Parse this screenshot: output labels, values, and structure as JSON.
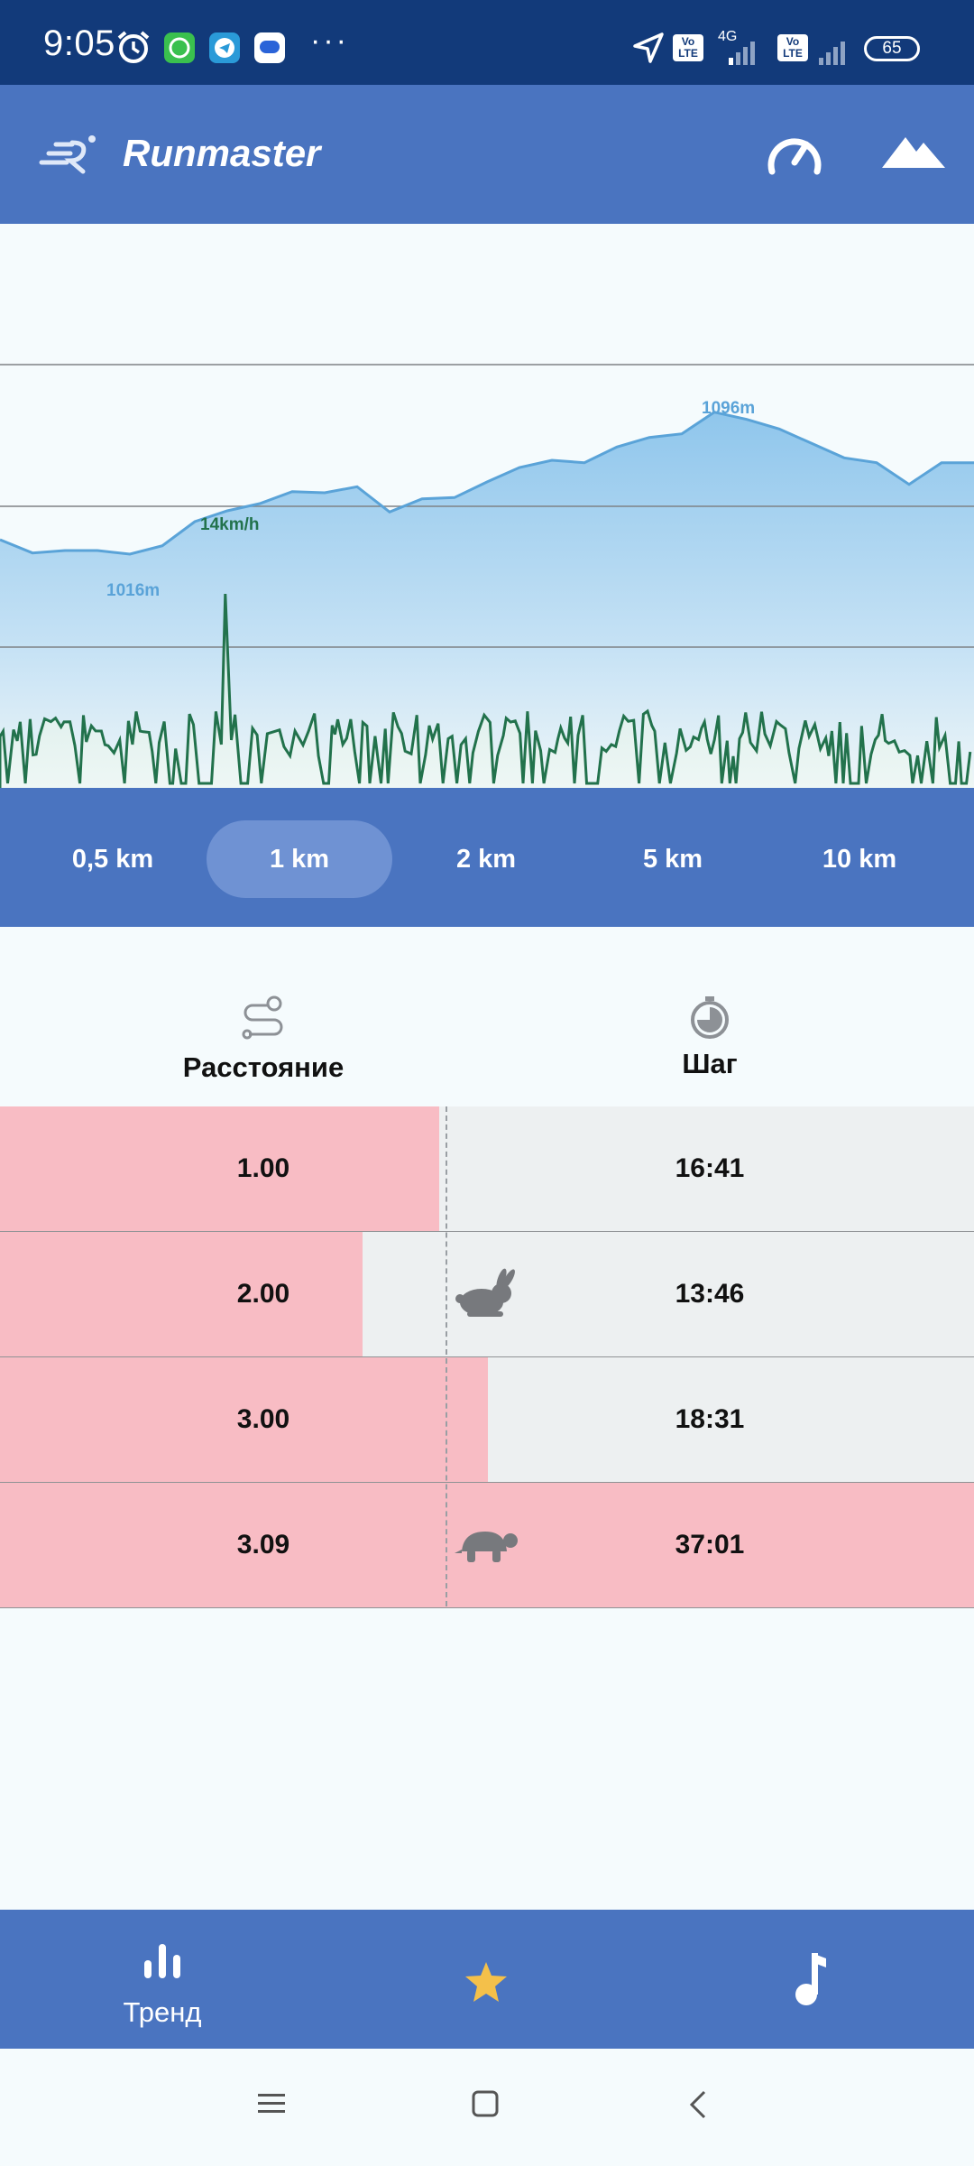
{
  "status_bar": {
    "time": "9:05",
    "icons": [
      "alarm-icon",
      "whatsapp-icon",
      "telegram-icon",
      "message-icon",
      "more-icon",
      "location-icon",
      "volte-icon",
      "signal-icon",
      "battery-icon"
    ],
    "network": "4G",
    "battery": "65"
  },
  "app_bar": {
    "title": "Runmaster",
    "icons": [
      "runmaster-logo-icon",
      "speedometer-icon",
      "mountain-icon"
    ],
    "accent": "#4a74c0"
  },
  "chart_data": {
    "type": "area",
    "series": [
      {
        "kind": "elevation",
        "unit": "m",
        "color": "#5aa3d8",
        "values": [
          1030,
          1019,
          1021,
          1021,
          1018,
          1025,
          1045,
          1054,
          1060,
          1070,
          1069,
          1074,
          1053,
          1064,
          1065,
          1078,
          1090,
          1096,
          1094,
          1107,
          1115,
          1118,
          1136,
          1130,
          1122,
          1110,
          1098,
          1094,
          1076,
          1094,
          1094
        ]
      },
      {
        "kind": "speed",
        "unit": "km/h",
        "color": "#22724c",
        "spike_value": 14
      }
    ],
    "annotations": [
      {
        "text": "1016m",
        "color": "#5aa3d8"
      },
      {
        "text": "1096m",
        "color": "#5aa3d8"
      },
      {
        "text": "14km/h",
        "color": "#22724c"
      }
    ],
    "gridlines": true
  },
  "segments": {
    "options": [
      "0,5 km",
      "1 km",
      "2 km",
      "5 km",
      "10 km"
    ],
    "selected_index": 1
  },
  "columns": {
    "distance": {
      "label": "Расстояние",
      "icon": "route-icon"
    },
    "pace": {
      "label": "Шаг",
      "icon": "stopwatch-icon"
    }
  },
  "splits": [
    {
      "distance": "1.00",
      "pace": "16:41",
      "bar_fraction": 0.451,
      "marker": ""
    },
    {
      "distance": "2.00",
      "pace": "13:46",
      "bar_fraction": 0.372,
      "marker": "rabbit-icon"
    },
    {
      "distance": "3.00",
      "pace": "18:31",
      "bar_fraction": 0.501,
      "marker": ""
    },
    {
      "distance": "3.09",
      "pace": "37:01",
      "bar_fraction": 1.0,
      "marker": "turtle-icon"
    }
  ],
  "colors": {
    "split_bar": "#f8bcc4",
    "row_bg": "#edf0f1",
    "star": "#f4c04a"
  },
  "bottom_nav": {
    "items": [
      {
        "label": "Тренд",
        "icon": "bar-chart-icon"
      },
      {
        "label": "",
        "icon": "star-icon"
      },
      {
        "label": "",
        "icon": "music-note-icon"
      }
    ]
  },
  "system_nav": {
    "icons": [
      "menu-icon",
      "home-icon",
      "back-icon"
    ]
  }
}
